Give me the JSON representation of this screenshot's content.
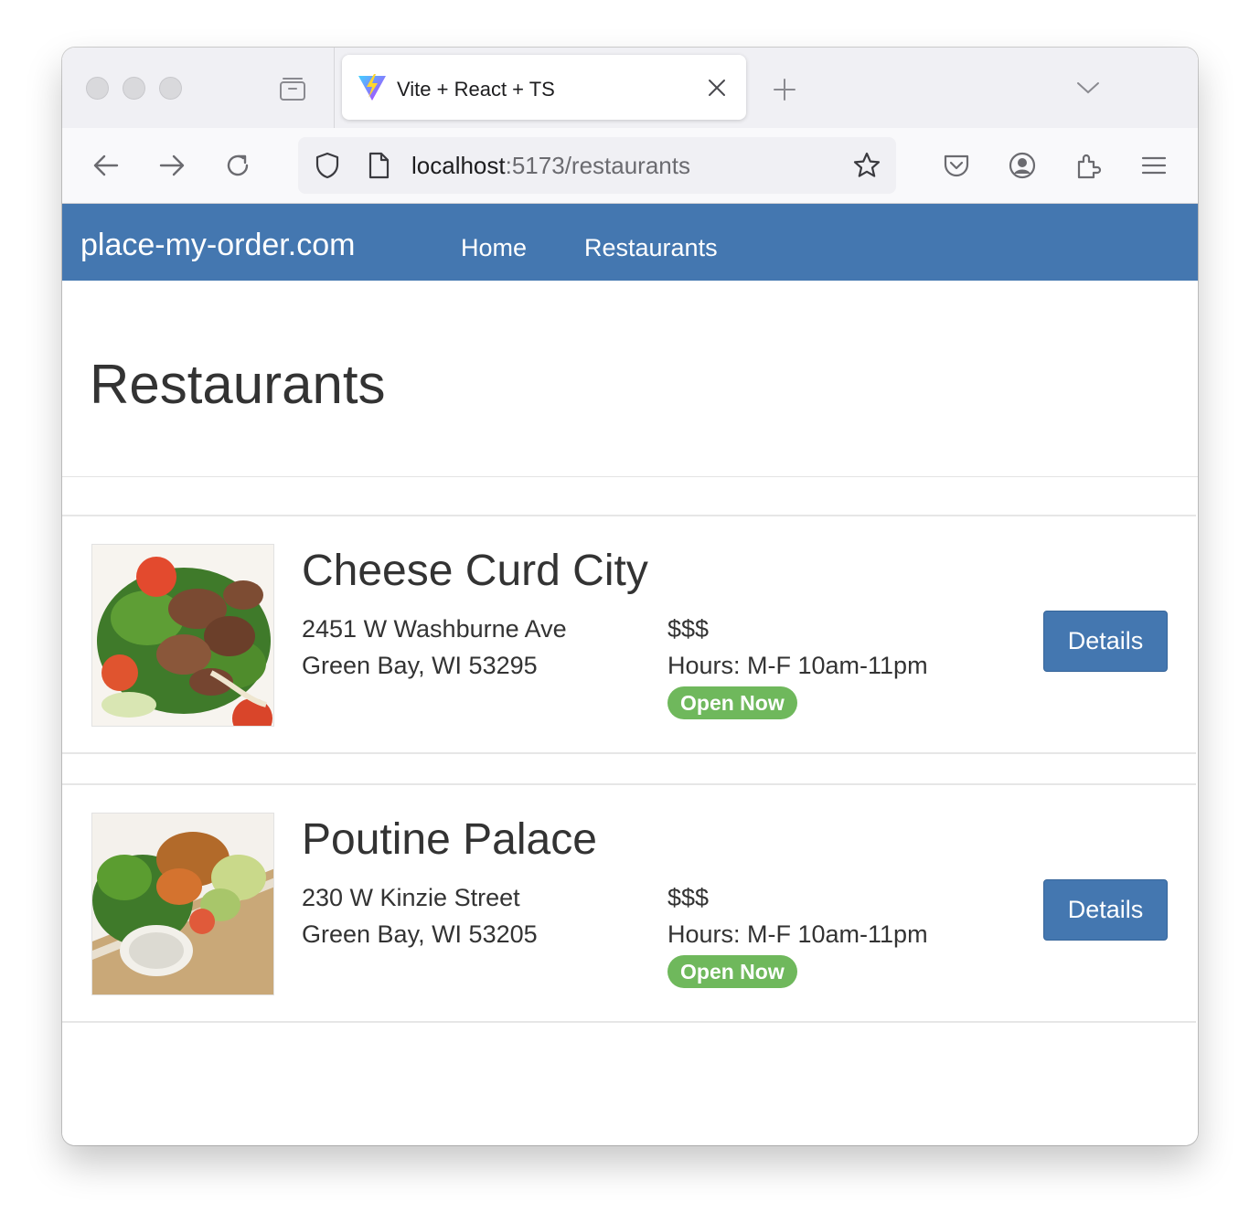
{
  "browser": {
    "tab_title": "Vite + React + TS",
    "url_host": "localhost",
    "url_path": ":5173/restaurants"
  },
  "navbar": {
    "brand": "place-my-order.com",
    "links": [
      {
        "label": "Home"
      },
      {
        "label": "Restaurants"
      }
    ]
  },
  "main": {
    "title": "Restaurants",
    "restaurants": [
      {
        "name": "Cheese Curd City",
        "address_line1": "2451 W Washburne Ave",
        "address_line2": "Green Bay, WI 53295",
        "price": "$$$",
        "hours": "Hours: M-F 10am-11pm",
        "status": "Open Now",
        "button": "Details"
      },
      {
        "name": "Poutine Palace",
        "address_line1": "230 W Kinzie Street",
        "address_line2": "Green Bay, WI 53205",
        "price": "$$$",
        "hours": "Hours: M-F 10am-11pm",
        "status": "Open Now",
        "button": "Details"
      }
    ]
  },
  "colors": {
    "navbar": "#4477b0",
    "badge": "#6fb85c"
  },
  "icons": [
    "tab-overview-icon",
    "vite-favicon-icon",
    "close-icon",
    "plus-icon",
    "chevron-down-icon",
    "back-arrow-icon",
    "forward-arrow-icon",
    "reload-icon",
    "shield-icon",
    "page-icon",
    "star-icon",
    "pocket-icon",
    "account-icon",
    "extensions-icon",
    "menu-icon"
  ]
}
